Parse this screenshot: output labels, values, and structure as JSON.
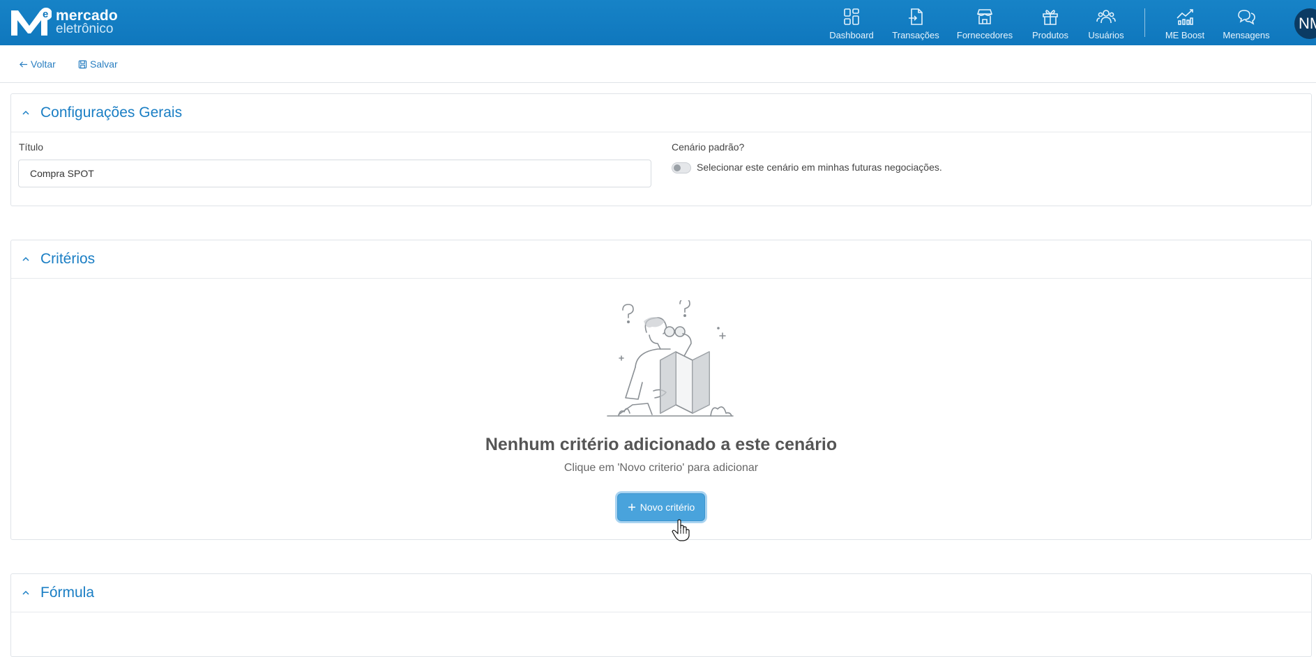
{
  "brand": {
    "line1": "mercado",
    "line2": "eletrônico",
    "mark_letter_main": "M",
    "mark_letter_small": "e"
  },
  "nav": {
    "items": [
      {
        "label": "Dashboard",
        "icon": "dashboard-icon"
      },
      {
        "label": "Transações",
        "icon": "document-arrow-icon"
      },
      {
        "label": "Fornecedores",
        "icon": "store-icon"
      },
      {
        "label": "Produtos",
        "icon": "box-icon"
      },
      {
        "label": "Usuários",
        "icon": "users-icon"
      },
      {
        "label": "ME Boost",
        "icon": "chart-line-icon"
      },
      {
        "label": "Mensagens",
        "icon": "chat-bubbles-icon"
      }
    ],
    "avatar": "NM"
  },
  "actions": {
    "back": "Voltar",
    "save": "Salvar"
  },
  "general": {
    "title": "Configurações Gerais",
    "field_title_label": "Título",
    "field_title_value": "Compra SPOT",
    "default_label": "Cenário padrão?",
    "default_toggle_text": "Selecionar este cenário em minhas futuras negociações."
  },
  "criteria": {
    "title": "Critérios",
    "empty_title": "Nenhum critério adicionado a este cenário",
    "empty_sub": "Clique em 'Novo criterio' para adicionar",
    "new_button": "Novo critério"
  },
  "formula": {
    "title": "Fórmula"
  },
  "colors": {
    "topbar": "#0f77bd",
    "accent": "#1a7ec4",
    "button": "#49a3dc"
  }
}
